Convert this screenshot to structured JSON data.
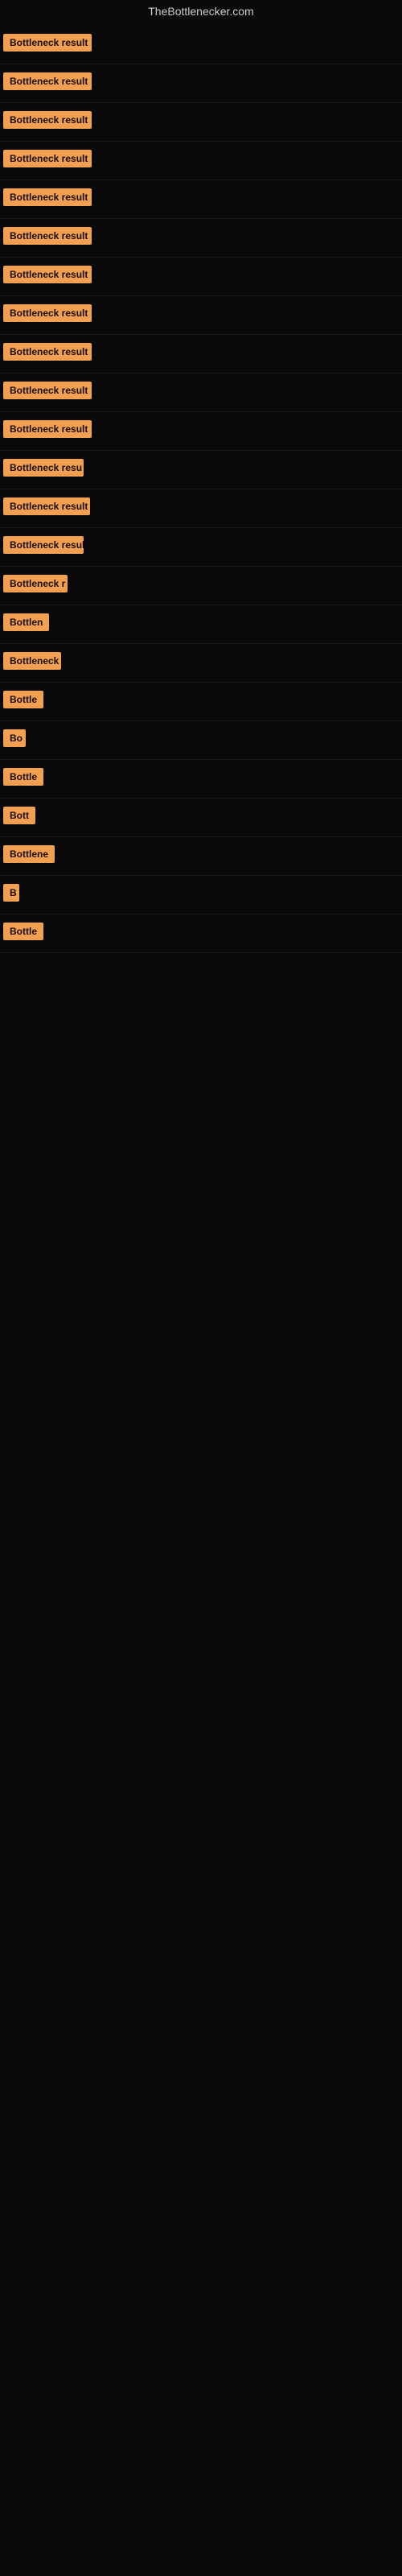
{
  "site": {
    "title": "TheBottlenecker.com"
  },
  "rows": [
    {
      "id": 1,
      "label": "Bottleneck result",
      "badge_width": 110
    },
    {
      "id": 2,
      "label": "Bottleneck result",
      "badge_width": 110
    },
    {
      "id": 3,
      "label": "Bottleneck result",
      "badge_width": 110
    },
    {
      "id": 4,
      "label": "Bottleneck result",
      "badge_width": 110
    },
    {
      "id": 5,
      "label": "Bottleneck result",
      "badge_width": 110
    },
    {
      "id": 6,
      "label": "Bottleneck result",
      "badge_width": 110
    },
    {
      "id": 7,
      "label": "Bottleneck result",
      "badge_width": 110
    },
    {
      "id": 8,
      "label": "Bottleneck result",
      "badge_width": 110
    },
    {
      "id": 9,
      "label": "Bottleneck result",
      "badge_width": 110
    },
    {
      "id": 10,
      "label": "Bottleneck result",
      "badge_width": 110
    },
    {
      "id": 11,
      "label": "Bottleneck result",
      "badge_width": 110
    },
    {
      "id": 12,
      "label": "Bottleneck resu",
      "badge_width": 100
    },
    {
      "id": 13,
      "label": "Bottleneck result",
      "badge_width": 108
    },
    {
      "id": 14,
      "label": "Bottleneck resul",
      "badge_width": 100
    },
    {
      "id": 15,
      "label": "Bottleneck r",
      "badge_width": 80
    },
    {
      "id": 16,
      "label": "Bottlen",
      "badge_width": 60
    },
    {
      "id": 17,
      "label": "Bottleneck",
      "badge_width": 72
    },
    {
      "id": 18,
      "label": "Bottle",
      "badge_width": 52
    },
    {
      "id": 19,
      "label": "Bo",
      "badge_width": 28
    },
    {
      "id": 20,
      "label": "Bottle",
      "badge_width": 52
    },
    {
      "id": 21,
      "label": "Bott",
      "badge_width": 40
    },
    {
      "id": 22,
      "label": "Bottlene",
      "badge_width": 65
    },
    {
      "id": 23,
      "label": "B",
      "badge_width": 20
    },
    {
      "id": 24,
      "label": "Bottle",
      "badge_width": 52
    }
  ]
}
